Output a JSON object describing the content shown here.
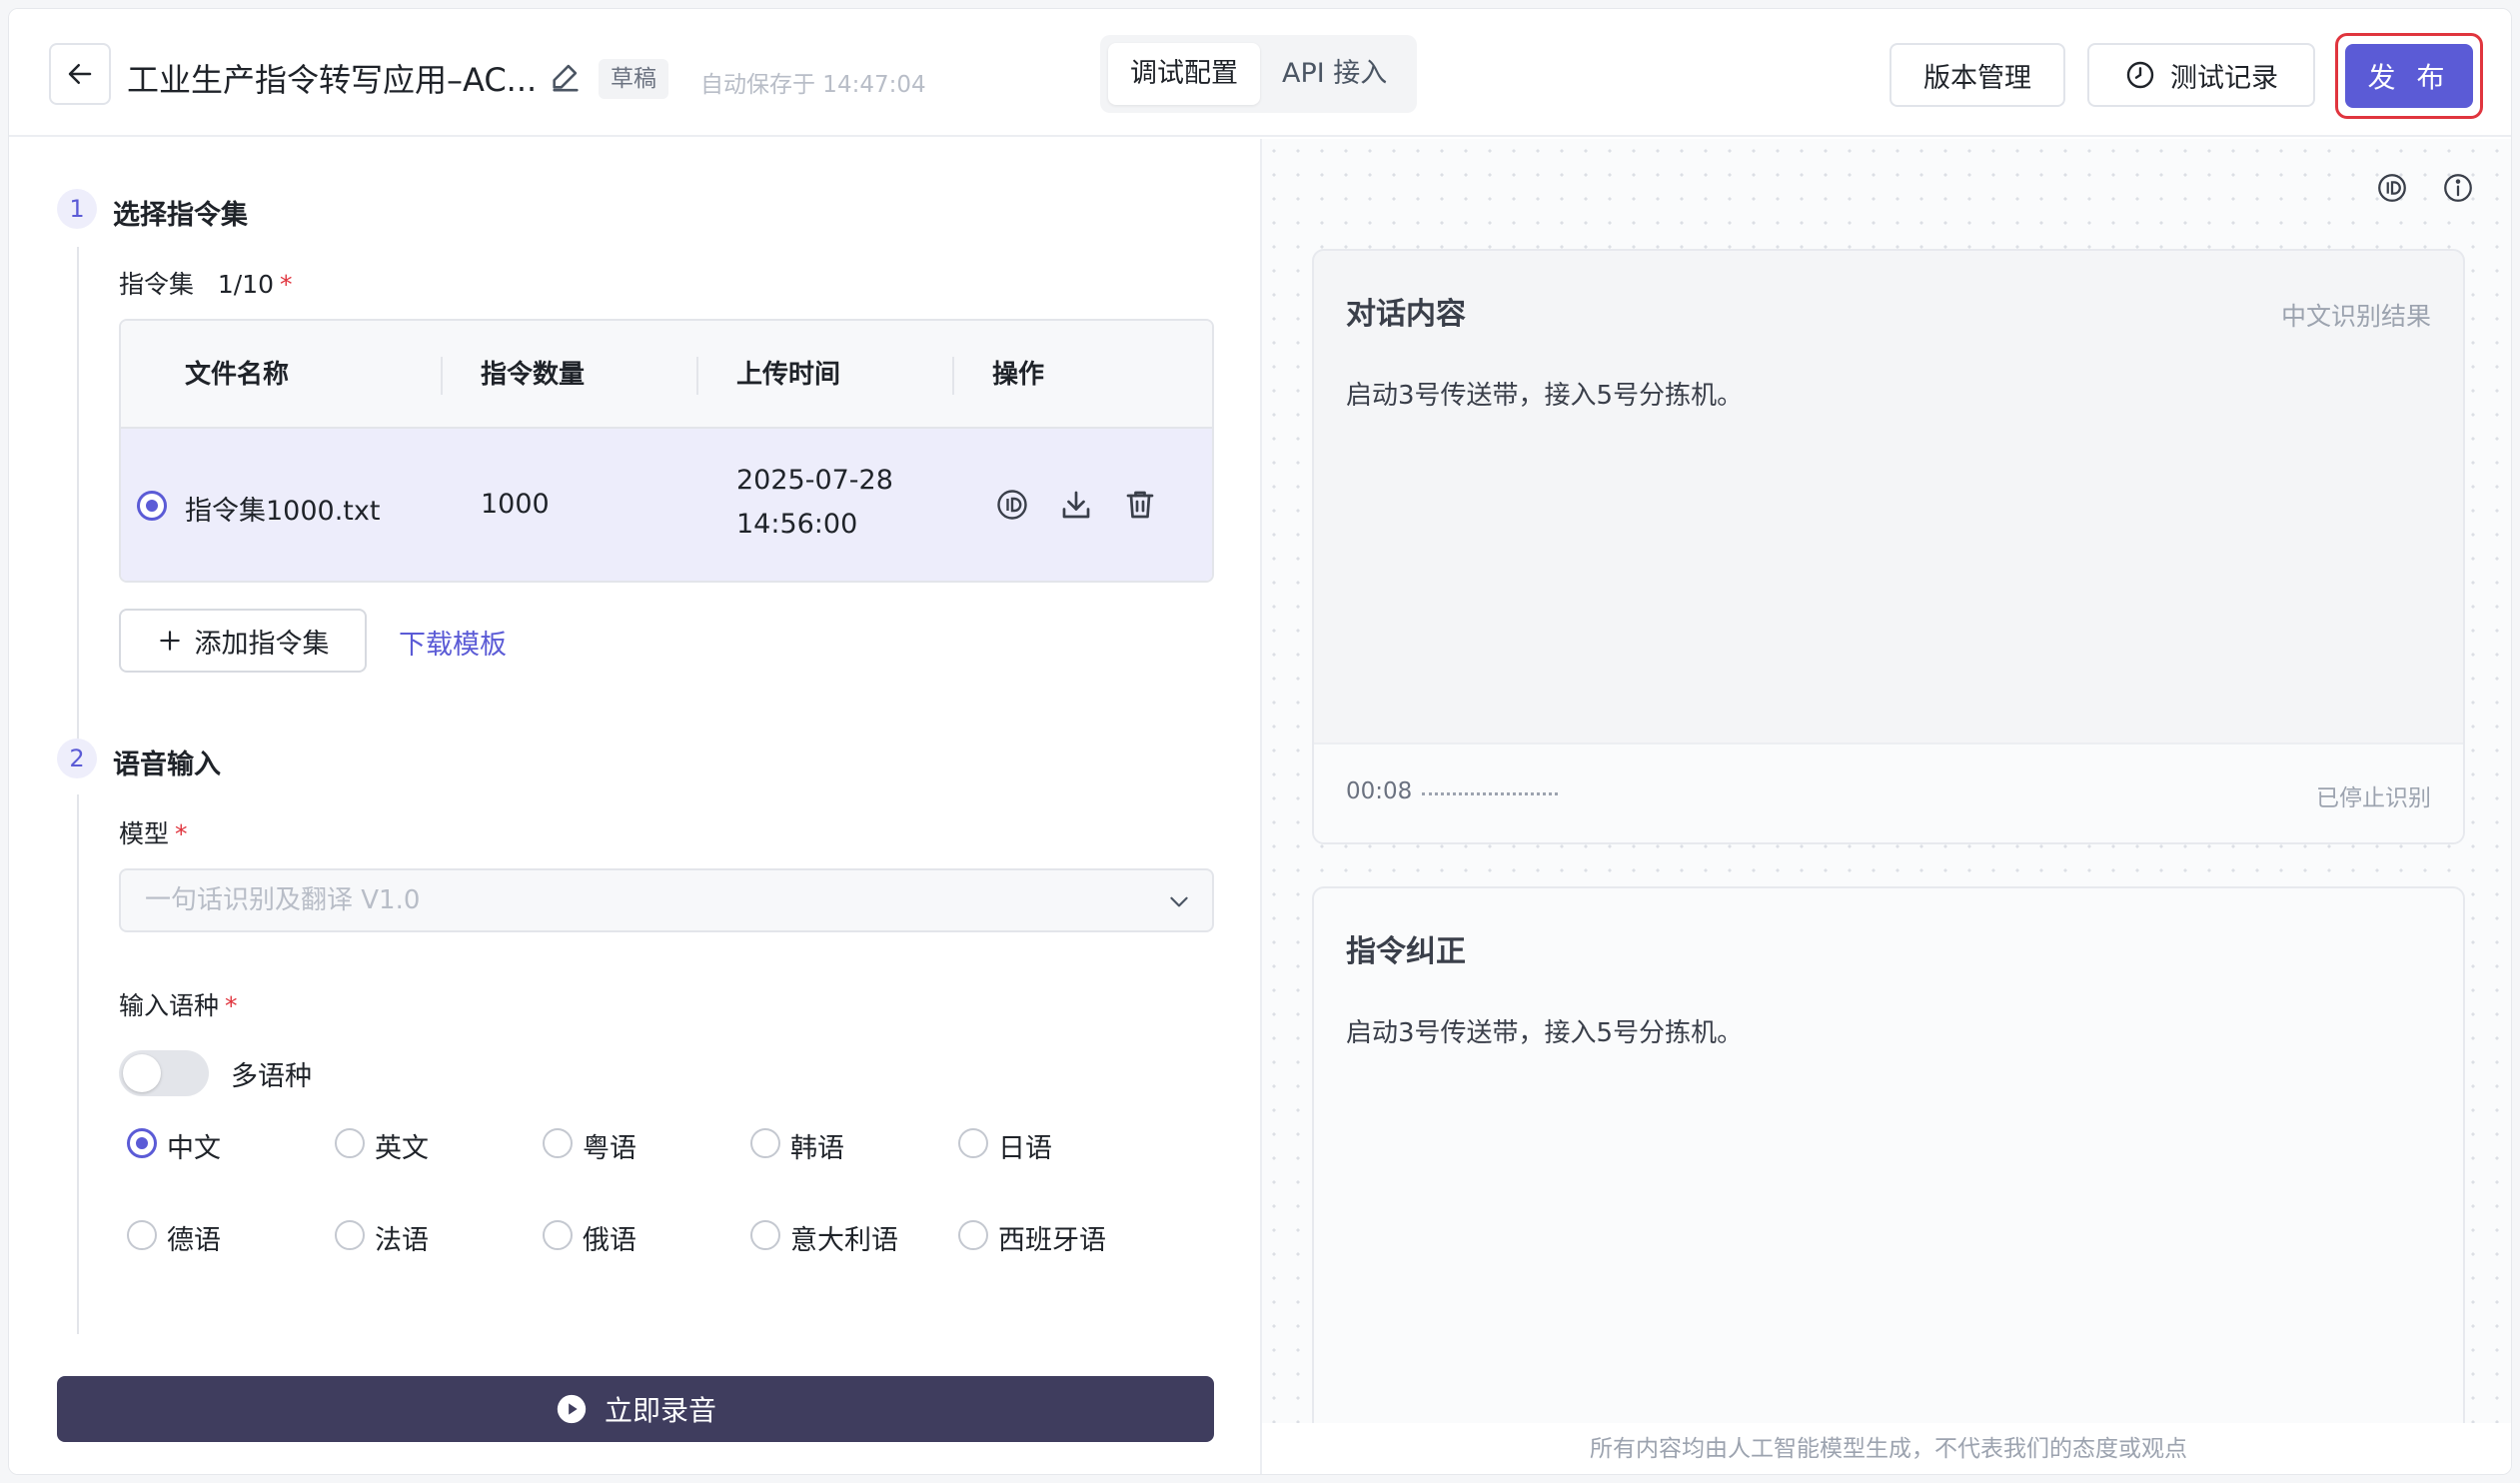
{
  "header": {
    "title": "工业生产指令转写应用–AC...",
    "status_badge": "草稿",
    "autosave": "自动保存于 14:47:04",
    "tabs": [
      {
        "label": "调试配置",
        "active": true
      },
      {
        "label": "API 接入",
        "active": false
      }
    ],
    "version_btn": "版本管理",
    "test_record_btn": "测试记录",
    "publish_btn": "发 布"
  },
  "step1": {
    "number": "1",
    "title": "选择指令集",
    "set_label": "指令集",
    "set_count": "1/10",
    "required_mark": "*",
    "table": {
      "headers": [
        "文件名称",
        "指令数量",
        "上传时间",
        "操作"
      ],
      "rows": [
        {
          "name": "指令集1000.txt",
          "count": "1000",
          "date": "2025-07-28",
          "time": "14:56:00",
          "selected": true
        }
      ]
    },
    "add_btn": "添加指令集",
    "download_template": "下载模板"
  },
  "step2": {
    "number": "2",
    "title": "语音输入",
    "model_label": "模型",
    "model_value": "一句话识别及翻译 V1.0",
    "lang_label": "输入语种",
    "multi_lang_label": "多语种",
    "multi_lang_enabled": false,
    "languages": [
      "中文",
      "英文",
      "粤语",
      "韩语",
      "日语",
      "德语",
      "法语",
      "俄语",
      "意大利语",
      "西班牙语"
    ],
    "selected_language": "中文"
  },
  "record_btn": "立即录音",
  "dialog": {
    "title": "对话内容",
    "mode": "中文识别结果",
    "text": "启动3号传送带，接入5号分拣机。",
    "timer": "00:08",
    "status": "已停止识别"
  },
  "correction": {
    "title": "指令纠正",
    "text": "启动3号传送带，接入5号分拣机。"
  },
  "disclaimer": "所有内容均由人工智能模型生成，不代表我们的态度或观点",
  "colors": {
    "accent": "#5b5bd6",
    "danger": "#e0353e",
    "record_bg": "#3f3d5e"
  }
}
